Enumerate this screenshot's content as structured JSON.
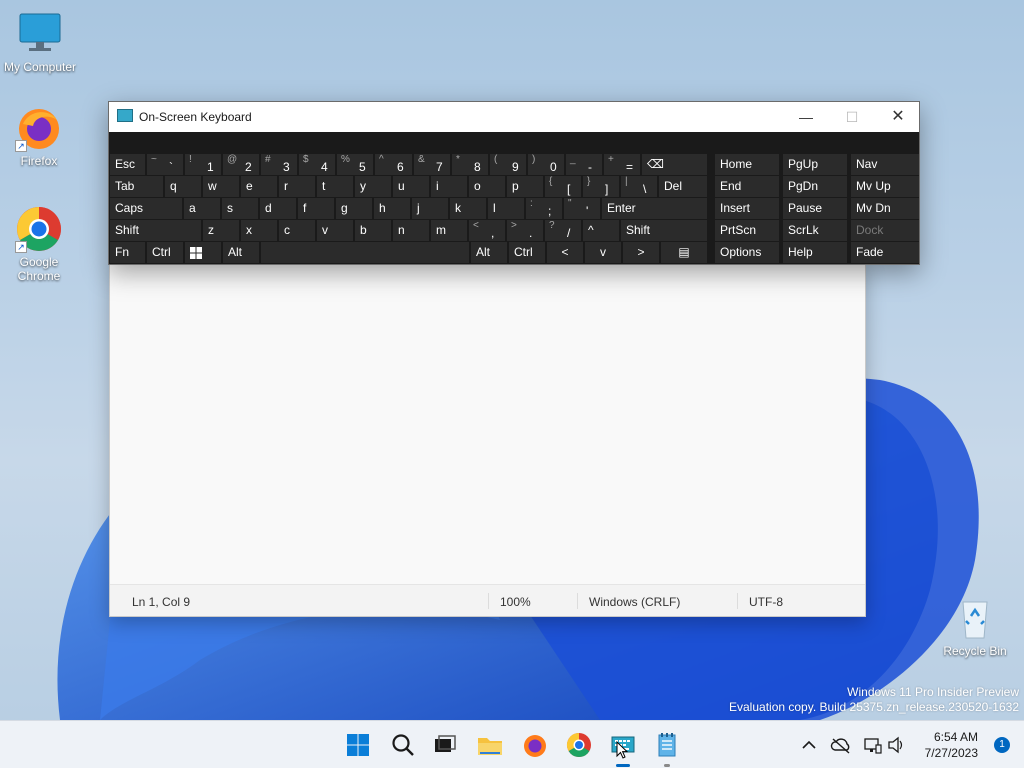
{
  "desktop": {
    "icons": [
      {
        "label": "My Computer"
      },
      {
        "label": "Firefox"
      },
      {
        "label": "Google Chrome"
      },
      {
        "label": "Recycle Bin"
      }
    ],
    "watermark_line1": "Windows 11 Pro Insider Preview",
    "watermark_line2": "Evaluation copy. Build 25375.zn_release.230520-1632"
  },
  "osk": {
    "title": "On-Screen Keyboard",
    "rows": [
      [
        {
          "main": "Esc"
        },
        {
          "shift": "~",
          "main": "`"
        },
        {
          "shift": "!",
          "main": "1"
        },
        {
          "shift": "@",
          "main": "2"
        },
        {
          "shift": "#",
          "main": "3"
        },
        {
          "shift": "$",
          "main": "4"
        },
        {
          "shift": "%",
          "main": "5"
        },
        {
          "shift": "^",
          "main": "6"
        },
        {
          "shift": "&",
          "main": "7"
        },
        {
          "shift": "*",
          "main": "8"
        },
        {
          "shift": "(",
          "main": "9"
        },
        {
          "shift": ")",
          "main": "0"
        },
        {
          "shift": "_",
          "main": "-"
        },
        {
          "shift": "+",
          "main": "="
        },
        {
          "main": "⌫"
        }
      ],
      [
        {
          "main": "Tab"
        },
        {
          "main": "q"
        },
        {
          "main": "w"
        },
        {
          "main": "e"
        },
        {
          "main": "r"
        },
        {
          "main": "t"
        },
        {
          "main": "y"
        },
        {
          "main": "u"
        },
        {
          "main": "i"
        },
        {
          "main": "o"
        },
        {
          "main": "p"
        },
        {
          "shift": "{",
          "main": "["
        },
        {
          "shift": "}",
          "main": "]"
        },
        {
          "shift": "|",
          "main": "\\"
        },
        {
          "main": "Del"
        }
      ],
      [
        {
          "main": "Caps"
        },
        {
          "main": "a"
        },
        {
          "main": "s"
        },
        {
          "main": "d"
        },
        {
          "main": "f"
        },
        {
          "main": "g"
        },
        {
          "main": "h"
        },
        {
          "main": "j"
        },
        {
          "main": "k"
        },
        {
          "main": "l"
        },
        {
          "shift": ":",
          "main": ";"
        },
        {
          "shift": "\"",
          "main": "'"
        },
        {
          "main": "Enter"
        }
      ],
      [
        {
          "main": "Shift"
        },
        {
          "main": "z"
        },
        {
          "main": "x"
        },
        {
          "main": "c"
        },
        {
          "main": "v"
        },
        {
          "main": "b"
        },
        {
          "main": "n"
        },
        {
          "main": "m"
        },
        {
          "shift": "<",
          "main": ","
        },
        {
          "shift": ">",
          "main": "."
        },
        {
          "shift": "?",
          "main": "/"
        },
        {
          "main": "^"
        },
        {
          "main": "Shift"
        }
      ],
      [
        {
          "main": "Fn"
        },
        {
          "main": "Ctrl"
        },
        {
          "main": ""
        },
        {
          "main": "Alt"
        },
        {
          "main": ""
        },
        {
          "main": "Alt"
        },
        {
          "main": "Ctrl"
        },
        {
          "main": "<"
        },
        {
          "main": "v"
        },
        {
          "main": ">"
        },
        {
          "main": "▤"
        }
      ]
    ],
    "nav_keys": [
      [
        "Home",
        "PgUp",
        "Nav"
      ],
      [
        "End",
        "PgDn",
        "Mv Up"
      ],
      [
        "Insert",
        "Pause",
        "Mv Dn"
      ],
      [
        "PrtScn",
        "ScrLk",
        "Dock"
      ],
      [
        "Options",
        "Help",
        "Fade"
      ]
    ]
  },
  "notepad": {
    "status": {
      "position": "Ln 1, Col 9",
      "zoom": "100%",
      "line_ending": "Windows (CRLF)",
      "encoding": "UTF-8"
    }
  },
  "taskbar": {
    "items": [
      "start-button",
      "search-button",
      "task-view-button",
      "file-explorer-button",
      "firefox-button",
      "chrome-button",
      "on-screen-keyboard-button",
      "notepad-button"
    ],
    "clock_time": "6:54 AM",
    "clock_date": "7/27/2023",
    "notifications": "1"
  }
}
